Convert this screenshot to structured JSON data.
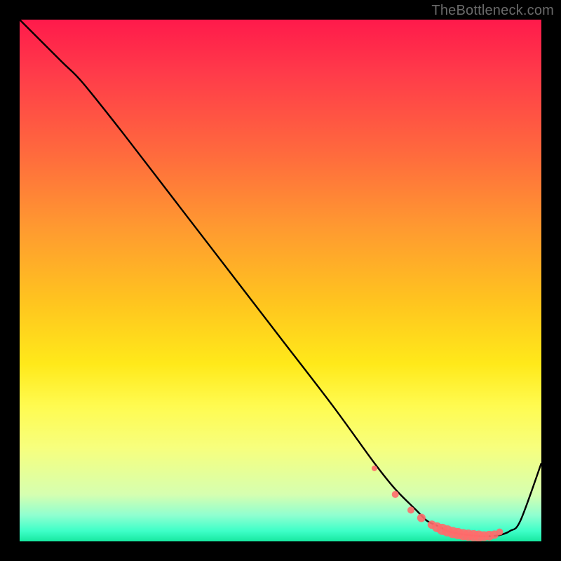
{
  "watermark": "TheBottleneck.com",
  "colors": {
    "background": "#000000",
    "curve": "#000000",
    "markers_fill": "#ff6b6b",
    "markers_stroke": "#ff6b6b",
    "gradient_top": "#ff1a4b",
    "gradient_bottom": "#17e8a0"
  },
  "chart_data": {
    "type": "line",
    "title": "",
    "xlabel": "",
    "ylabel": "",
    "xlim": [
      0,
      100
    ],
    "ylim": [
      0,
      100
    ],
    "grid": false,
    "legend_position": "none",
    "series": [
      {
        "name": "bottleneck-curve",
        "x": [
          0,
          8,
          12,
          20,
          30,
          40,
          50,
          60,
          68,
          72,
          76,
          78,
          80,
          82,
          84,
          86,
          88,
          90,
          92,
          94,
          96,
          100
        ],
        "values": [
          100,
          92,
          88,
          78,
          65,
          52,
          39,
          26,
          15,
          10,
          6,
          4,
          3,
          2,
          1.5,
          1.2,
          1,
          1,
          1.2,
          2,
          4,
          15
        ]
      }
    ],
    "markers": {
      "name": "highlight-dots",
      "x": [
        68,
        72,
        75,
        77,
        79,
        80,
        81,
        82,
        83,
        84,
        85,
        86,
        87,
        88,
        89,
        90,
        91,
        92
      ],
      "values": [
        14,
        9,
        6,
        4.5,
        3.2,
        2.7,
        2.3,
        2.0,
        1.7,
        1.5,
        1.3,
        1.2,
        1.1,
        1.0,
        1.0,
        1.1,
        1.3,
        1.8
      ],
      "radius": [
        4,
        5,
        5,
        6,
        6,
        7,
        8,
        8,
        8,
        8,
        8,
        8,
        8,
        8,
        7,
        7,
        6,
        5
      ]
    }
  }
}
